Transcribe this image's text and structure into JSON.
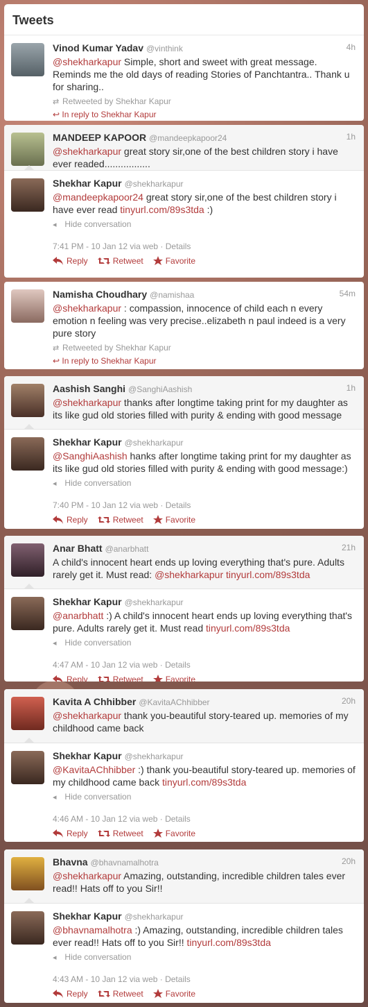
{
  "header": {
    "title": "Tweets"
  },
  "common": {
    "reply": "Reply",
    "retweet": "Retweet",
    "favorite": "Favorite",
    "hide_conversation": "Hide conversation",
    "details": "Details"
  },
  "threads": [
    {
      "parent": {
        "name": "Vinod Kumar Yadav",
        "handle": "@vinthink",
        "time": "4h",
        "mention": "@shekharkapur",
        "text": " Simple, short and sweet with great message. Reminds me the old days of reading Stories of Panchtantra.. Thank u for sharing..",
        "retweeted": "Retweeted by Shekhar Kapur",
        "in_reply": "In reply to Shekhar Kapur",
        "avatar_color": "#7f8a90"
      }
    },
    {
      "parent": {
        "name": "MANDEEP KAPOOR",
        "handle": "@mandeepkapoor24",
        "time": "1h",
        "mention": "@shekharkapur",
        "text": " great story sir,one of the best children story i have ever readed.................",
        "avatar_color": "#8f9a6a"
      },
      "reply": {
        "name": "Shekhar Kapur",
        "handle": "@shekharkapur",
        "mention": "@mandeepkapoor24",
        "text": " great story sir,one of the best children story i have ever read ",
        "link": "tinyurl.com/89s3tda",
        "trail": " :)",
        "stamp": "7:41 PM - 10 Jan 12 via web · ",
        "avatar_color": "#6b5040"
      }
    },
    {
      "parent": {
        "name": "Namisha Choudhary",
        "handle": "@namishaa",
        "time": "54m",
        "mention": "@shekharkapur",
        "text": " : compassion, innocence of child each n every emotion n feeling was very precise..elizabeth n paul indeed is a very pure story",
        "retweeted": "Retweeted by Shekhar Kapur",
        "in_reply": "In reply to Shekhar Kapur",
        "avatar_color": "#c9a9a0"
      }
    },
    {
      "parent": {
        "name": "Aashish Sanghi",
        "handle": "@SanghiAashish",
        "time": "1h",
        "mention": "@shekharkapur",
        "text": " thanks after longtime taking print for my daughter as its like gud old stories filled with purity & ending with good message",
        "avatar_color": "#7a5a48"
      },
      "reply": {
        "name": "Shekhar Kapur",
        "handle": "@shekharkapur",
        "mention": "@SanghiAashish",
        "text": " hanks after longtime taking print for my daughter as its like gud old stories filled with purity & ending with good message:)",
        "link": "",
        "trail": "",
        "stamp": "7:40 PM - 10 Jan 12 via web · ",
        "avatar_color": "#6b5040"
      }
    },
    {
      "parent": {
        "name": "Anar Bhatt",
        "handle": "@anarbhatt",
        "time": "21h",
        "mention": "",
        "text": "A child's innocent heart ends up loving everything that's pure. Adults rarely get it. Must read: ",
        "link_mention": "@shekharkapur",
        "link": "tinyurl.com/89s3tda",
        "avatar_color": "#5a4050"
      },
      "reply": {
        "name": "Shekhar Kapur",
        "handle": "@shekharkapur",
        "mention": "@anarbhatt",
        "text": " :) A child's innocent heart ends up loving everything that's pure. Adults rarely get it. Must read ",
        "link": "tinyurl.com/89s3tda",
        "trail": "",
        "stamp": "4:47 AM - 10 Jan 12 via web · ",
        "avatar_color": "#6b5040"
      }
    },
    {
      "parent": {
        "name": "Kavita A Chhibber",
        "handle": "@KavitaAChhibber",
        "time": "20h",
        "mention": "@shekharkapur",
        "text": " thank you-beautiful story-teared up. memories of my childhood came back",
        "avatar_color": "#a04a3a"
      },
      "reply": {
        "name": "Shekhar Kapur",
        "handle": "@shekharkapur",
        "mention": "@KavitaAChhibber",
        "text": " :) thank you-beautiful story-teared up. memories of my childhood came back ",
        "link": "tinyurl.com/89s3tda",
        "trail": "",
        "stamp": "4:46 AM - 10 Jan 12 via web · ",
        "avatar_color": "#6b5040"
      }
    },
    {
      "parent": {
        "name": "Bhavna",
        "handle": "@bhavnamalhotra",
        "time": "20h",
        "mention": "@shekharkapur",
        "text": " Amazing, outstanding, incredible children tales ever read!! Hats off to you Sir!!",
        "avatar_color": "#c8902a"
      },
      "reply": {
        "name": "Shekhar Kapur",
        "handle": "@shekharkapur",
        "mention": "@bhavnamalhotra",
        "text": " :) Amazing, outstanding, incredible children tales ever read!! Hats off to you Sir!! ",
        "link": "tinyurl.com/89s3tda",
        "trail": "",
        "stamp": "4:43 AM - 10 Jan 12 via web · ",
        "avatar_color": "#6b5040"
      }
    }
  ]
}
